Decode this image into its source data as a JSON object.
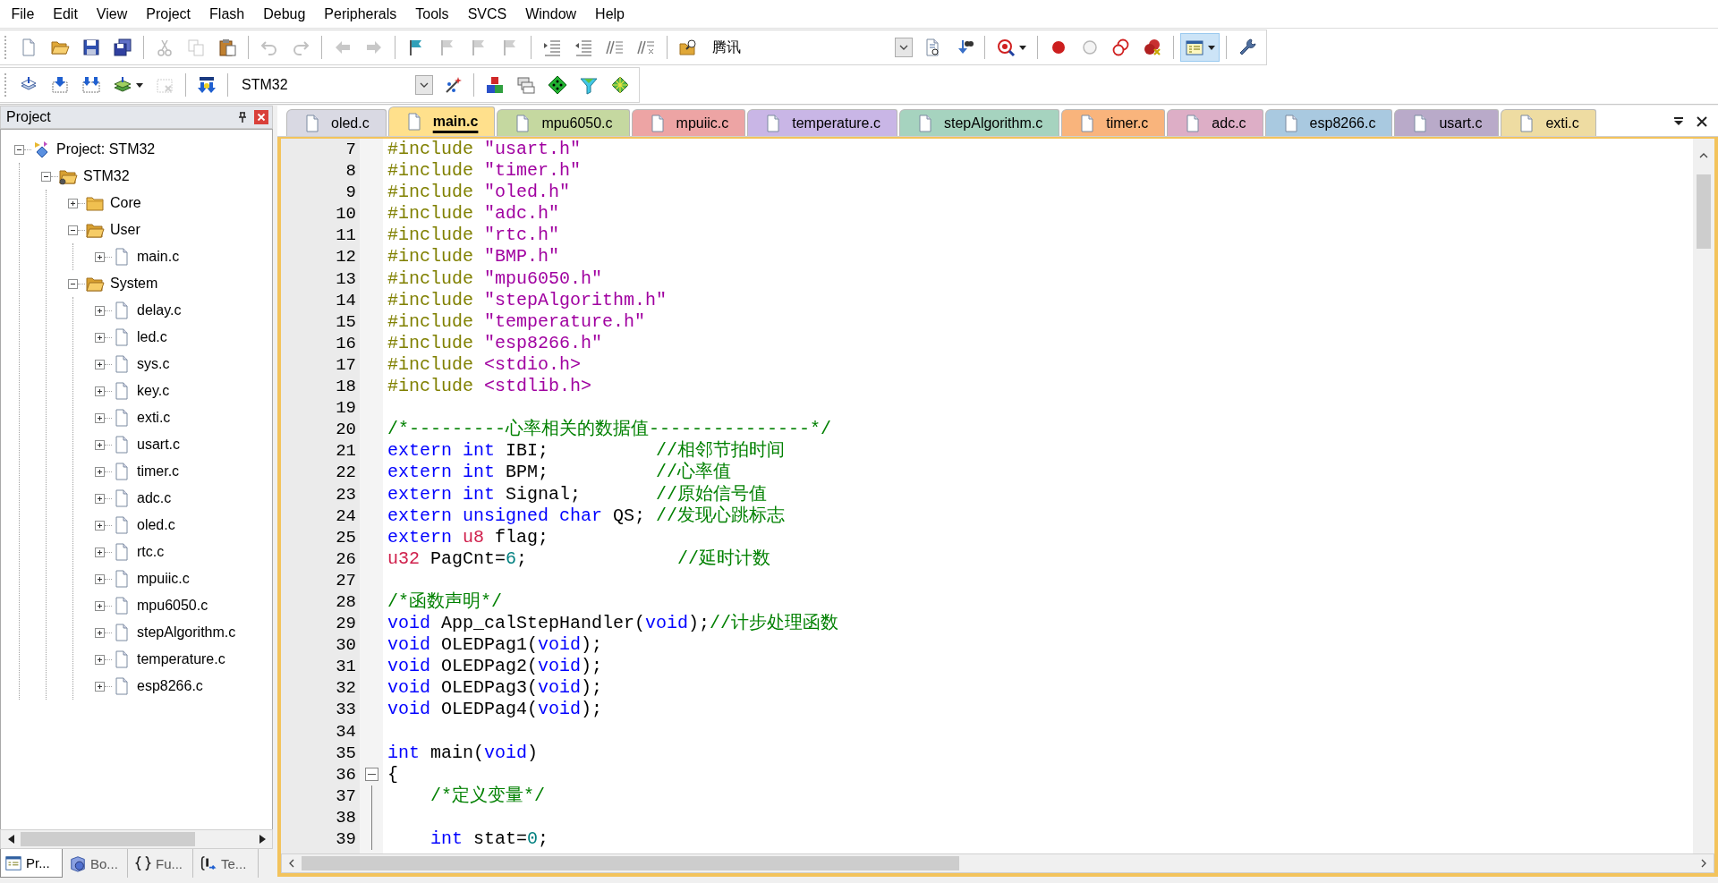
{
  "menu": [
    "File",
    "Edit",
    "View",
    "Project",
    "Flash",
    "Debug",
    "Peripherals",
    "Tools",
    "SVCS",
    "Window",
    "Help"
  ],
  "toolbars": [
    {
      "buttons": [
        {
          "disabled": false,
          "on": false
        },
        {
          "disabled": false,
          "on": false
        },
        {
          "disabled": false,
          "on": false
        },
        {
          "disabled": false,
          "on": false
        },
        {
          "disabled": true,
          "on": false
        },
        {
          "disabled": true,
          "on": false
        },
        {
          "disabled": false,
          "on": false
        },
        {
          "disabled": true,
          "on": false
        },
        {
          "disabled": true,
          "on": false
        },
        {
          "disabled": true,
          "on": false
        },
        {
          "disabled": true,
          "on": false
        },
        {
          "disabled": false,
          "on": false
        },
        {
          "disabled": true,
          "on": false
        },
        {
          "disabled": true,
          "on": false
        },
        {
          "disabled": true,
          "on": false
        },
        {
          "disabled": false,
          "on": false
        },
        {
          "disabled": false,
          "on": false
        },
        {
          "disabled": false,
          "on": false
        },
        {
          "disabled": false,
          "on": false
        },
        {
          "disabled": false,
          "on": false
        },
        {
          "disabled": false,
          "on": false
        },
        {
          "disabled": false,
          "on": false
        },
        {
          "disabled": false,
          "on": false
        },
        {
          "disabled": false,
          "on": false
        },
        {
          "disabled": false,
          "on": false
        },
        {
          "disabled": false,
          "on": false
        },
        {
          "disabled": false,
          "on": false
        },
        {
          "disabled": false,
          "on": true
        },
        {
          "disabled": false,
          "on": false
        }
      ],
      "combo": {
        "value": "腾讯"
      }
    },
    {
      "buttons": [
        {
          "disabled": false,
          "on": false
        },
        {
          "disabled": false,
          "on": false
        },
        {
          "disabled": false,
          "on": false
        },
        {
          "disabled": false,
          "on": false
        },
        {
          "disabled": true,
          "on": false
        },
        {
          "disabled": false,
          "on": false
        },
        {
          "disabled": false,
          "on": false
        },
        {
          "disabled": false,
          "on": false
        },
        {
          "disabled": false,
          "on": false
        },
        {
          "disabled": false,
          "on": false
        },
        {
          "disabled": false,
          "on": false
        },
        {
          "disabled": false,
          "on": false
        }
      ],
      "combo": {
        "value": "STM32"
      }
    }
  ],
  "project_panel": {
    "title": "Project",
    "tree": [
      {
        "label": "Project: STM32",
        "kind": "project",
        "expanded": true,
        "children": [
          {
            "label": "STM32",
            "kind": "target",
            "expanded": true,
            "children": [
              {
                "label": "Core",
                "kind": "group",
                "expanded": false
              },
              {
                "label": "User",
                "kind": "group",
                "expanded": true,
                "children": [
                  {
                    "label": "main.c",
                    "kind": "file",
                    "expanded": false
                  }
                ]
              },
              {
                "label": "System",
                "kind": "group",
                "expanded": true,
                "children": [
                  {
                    "label": "delay.c",
                    "kind": "file",
                    "expanded": false
                  },
                  {
                    "label": "led.c",
                    "kind": "file",
                    "expanded": false
                  },
                  {
                    "label": "sys.c",
                    "kind": "file",
                    "expanded": false
                  },
                  {
                    "label": "key.c",
                    "kind": "file",
                    "expanded": false
                  },
                  {
                    "label": "exti.c",
                    "kind": "file",
                    "expanded": false
                  },
                  {
                    "label": "usart.c",
                    "kind": "file",
                    "expanded": false
                  },
                  {
                    "label": "timer.c",
                    "kind": "file",
                    "expanded": false
                  },
                  {
                    "label": "adc.c",
                    "kind": "file",
                    "expanded": false
                  },
                  {
                    "label": "oled.c",
                    "kind": "file",
                    "expanded": false
                  },
                  {
                    "label": "rtc.c",
                    "kind": "file",
                    "expanded": false
                  },
                  {
                    "label": "mpuiic.c",
                    "kind": "file",
                    "expanded": false
                  },
                  {
                    "label": "mpu6050.c",
                    "kind": "file",
                    "expanded": false
                  },
                  {
                    "label": "stepAlgorithm.c",
                    "kind": "file",
                    "expanded": false
                  },
                  {
                    "label": "temperature.c",
                    "kind": "file",
                    "expanded": false
                  },
                  {
                    "label": "esp8266.c",
                    "kind": "file",
                    "expanded": false
                  }
                ]
              }
            ]
          }
        ]
      }
    ],
    "tabs": [
      {
        "label": "Pr...",
        "selected": true
      },
      {
        "label": "Bo...",
        "selected": false
      },
      {
        "label": "Fu...",
        "selected": false
      },
      {
        "label": "Te...",
        "selected": false
      }
    ]
  },
  "editor": {
    "tabs": [
      {
        "label": "oled.c",
        "color": "#d9d9e3",
        "selected": false
      },
      {
        "label": "main.c",
        "color": "#ffe08c",
        "selected": true
      },
      {
        "label": "mpu6050.c",
        "color": "#c5d8a0",
        "selected": false
      },
      {
        "label": "mpuiic.c",
        "color": "#eda4a4",
        "selected": false
      },
      {
        "label": "temperature.c",
        "color": "#c9b6e6",
        "selected": false
      },
      {
        "label": "stepAlgorithm.c",
        "color": "#a6d3bf",
        "selected": false
      },
      {
        "label": "timer.c",
        "color": "#f9b47c",
        "selected": false
      },
      {
        "label": "adc.c",
        "color": "#ddaec6",
        "selected": false
      },
      {
        "label": "esp8266.c",
        "color": "#a9c9e0",
        "selected": false
      },
      {
        "label": "usart.c",
        "color": "#b9aac9",
        "selected": false
      },
      {
        "label": "exti.c",
        "color": "#eedca2",
        "selected": false
      }
    ],
    "lines": [
      {
        "number": "7",
        "tokens": [
          {
            "kind": "preprocessor",
            "text": "#include "
          },
          {
            "kind": "string",
            "text": "\"usart.h\""
          }
        ]
      },
      {
        "number": "8",
        "tokens": [
          {
            "kind": "preprocessor",
            "text": "#include "
          },
          {
            "kind": "string",
            "text": "\"timer.h\""
          }
        ]
      },
      {
        "number": "9",
        "tokens": [
          {
            "kind": "preprocessor",
            "text": "#include "
          },
          {
            "kind": "string",
            "text": "\"oled.h\""
          }
        ]
      },
      {
        "number": "10",
        "tokens": [
          {
            "kind": "preprocessor",
            "text": "#include "
          },
          {
            "kind": "string",
            "text": "\"adc.h\""
          }
        ]
      },
      {
        "number": "11",
        "tokens": [
          {
            "kind": "preprocessor",
            "text": "#include "
          },
          {
            "kind": "string",
            "text": "\"rtc.h\""
          }
        ]
      },
      {
        "number": "12",
        "tokens": [
          {
            "kind": "preprocessor",
            "text": "#include "
          },
          {
            "kind": "string",
            "text": "\"BMP.h\""
          }
        ]
      },
      {
        "number": "13",
        "tokens": [
          {
            "kind": "preprocessor",
            "text": "#include "
          },
          {
            "kind": "string",
            "text": "\"mpu6050.h\""
          }
        ]
      },
      {
        "number": "14",
        "tokens": [
          {
            "kind": "preprocessor",
            "text": "#include "
          },
          {
            "kind": "string",
            "text": "\"stepAlgorithm.h\""
          }
        ]
      },
      {
        "number": "15",
        "tokens": [
          {
            "kind": "preprocessor",
            "text": "#include "
          },
          {
            "kind": "string",
            "text": "\"temperature.h\""
          }
        ]
      },
      {
        "number": "16",
        "tokens": [
          {
            "kind": "preprocessor",
            "text": "#include "
          },
          {
            "kind": "string",
            "text": "\"esp8266.h\""
          }
        ]
      },
      {
        "number": "17",
        "tokens": [
          {
            "kind": "preprocessor",
            "text": "#include "
          },
          {
            "kind": "string",
            "text": "<stdio.h>"
          }
        ]
      },
      {
        "number": "18",
        "tokens": [
          {
            "kind": "preprocessor",
            "text": "#include "
          },
          {
            "kind": "string",
            "text": "<stdlib.h>"
          }
        ]
      },
      {
        "number": "19"
      },
      {
        "number": "20",
        "tokens": [
          {
            "kind": "comment",
            "text": "/*---------心率相关的数据值---------------*/"
          }
        ]
      },
      {
        "number": "21",
        "tokens": [
          {
            "kind": "keyword",
            "text": "extern int"
          },
          {
            "kind": "plain",
            "text": " IBI;          "
          },
          {
            "kind": "comment",
            "text": "//相邻节拍时间"
          }
        ]
      },
      {
        "number": "22",
        "tokens": [
          {
            "kind": "keyword",
            "text": "extern int"
          },
          {
            "kind": "plain",
            "text": " BPM;          "
          },
          {
            "kind": "comment",
            "text": "//心率值"
          }
        ]
      },
      {
        "number": "23",
        "tokens": [
          {
            "kind": "keyword",
            "text": "extern int"
          },
          {
            "kind": "plain",
            "text": " Signal;       "
          },
          {
            "kind": "comment",
            "text": "//原始信号值"
          }
        ]
      },
      {
        "number": "24",
        "tokens": [
          {
            "kind": "keyword",
            "text": "extern unsigned char"
          },
          {
            "kind": "plain",
            "text": " QS; "
          },
          {
            "kind": "comment",
            "text": "//发现心跳标志"
          }
        ]
      },
      {
        "number": "25",
        "tokens": [
          {
            "kind": "keyword",
            "text": "extern "
          },
          {
            "kind": "type",
            "text": "u8"
          },
          {
            "kind": "plain",
            "text": " flag;"
          }
        ]
      },
      {
        "number": "26",
        "tokens": [
          {
            "kind": "type",
            "text": "u32"
          },
          {
            "kind": "plain",
            "text": " PagCnt="
          },
          {
            "kind": "number",
            "text": "6"
          },
          {
            "kind": "plain",
            "text": ";              "
          },
          {
            "kind": "comment",
            "text": "//延时计数"
          }
        ]
      },
      {
        "number": "27"
      },
      {
        "number": "28",
        "tokens": [
          {
            "kind": "comment",
            "text": "/*函数声明*/"
          }
        ]
      },
      {
        "number": "29",
        "tokens": [
          {
            "kind": "keyword",
            "text": "void"
          },
          {
            "kind": "plain",
            "text": " App_calStepHandler("
          },
          {
            "kind": "keyword",
            "text": "void"
          },
          {
            "kind": "plain",
            "text": ");"
          },
          {
            "kind": "comment",
            "text": "//计步处理函数"
          }
        ]
      },
      {
        "number": "30",
        "tokens": [
          {
            "kind": "keyword",
            "text": "void"
          },
          {
            "kind": "plain",
            "text": " OLEDPag1("
          },
          {
            "kind": "keyword",
            "text": "void"
          },
          {
            "kind": "plain",
            "text": ");"
          }
        ]
      },
      {
        "number": "31",
        "tokens": [
          {
            "kind": "keyword",
            "text": "void"
          },
          {
            "kind": "plain",
            "text": " OLEDPag2("
          },
          {
            "kind": "keyword",
            "text": "void"
          },
          {
            "kind": "plain",
            "text": ");"
          }
        ]
      },
      {
        "number": "32",
        "tokens": [
          {
            "kind": "keyword",
            "text": "void"
          },
          {
            "kind": "plain",
            "text": " OLEDPag3("
          },
          {
            "kind": "keyword",
            "text": "void"
          },
          {
            "kind": "plain",
            "text": ");"
          }
        ]
      },
      {
        "number": "33",
        "tokens": [
          {
            "kind": "keyword",
            "text": "void"
          },
          {
            "kind": "plain",
            "text": " OLEDPag4("
          },
          {
            "kind": "keyword",
            "text": "void"
          },
          {
            "kind": "plain",
            "text": ");"
          }
        ]
      },
      {
        "number": "34"
      },
      {
        "number": "35",
        "tokens": [
          {
            "kind": "keyword",
            "text": "int"
          },
          {
            "kind": "plain",
            "text": " main("
          },
          {
            "kind": "keyword",
            "text": "void"
          },
          {
            "kind": "plain",
            "text": ")"
          }
        ]
      },
      {
        "number": "36",
        "fold": {
          "expanded": true
        },
        "tokens": [
          {
            "kind": "plain",
            "text": "{"
          }
        ]
      },
      {
        "number": "37",
        "in_fold": true,
        "tokens": [
          {
            "kind": "comment",
            "text": "    /*定义变量*/"
          }
        ]
      },
      {
        "number": "38",
        "in_fold": true
      },
      {
        "number": "39",
        "in_fold": true,
        "tokens": [
          {
            "kind": "keyword",
            "text": "    int"
          },
          {
            "kind": "plain",
            "text": " stat="
          },
          {
            "kind": "number",
            "text": "0"
          },
          {
            "kind": "plain",
            "text": ";"
          }
        ]
      }
    ]
  }
}
